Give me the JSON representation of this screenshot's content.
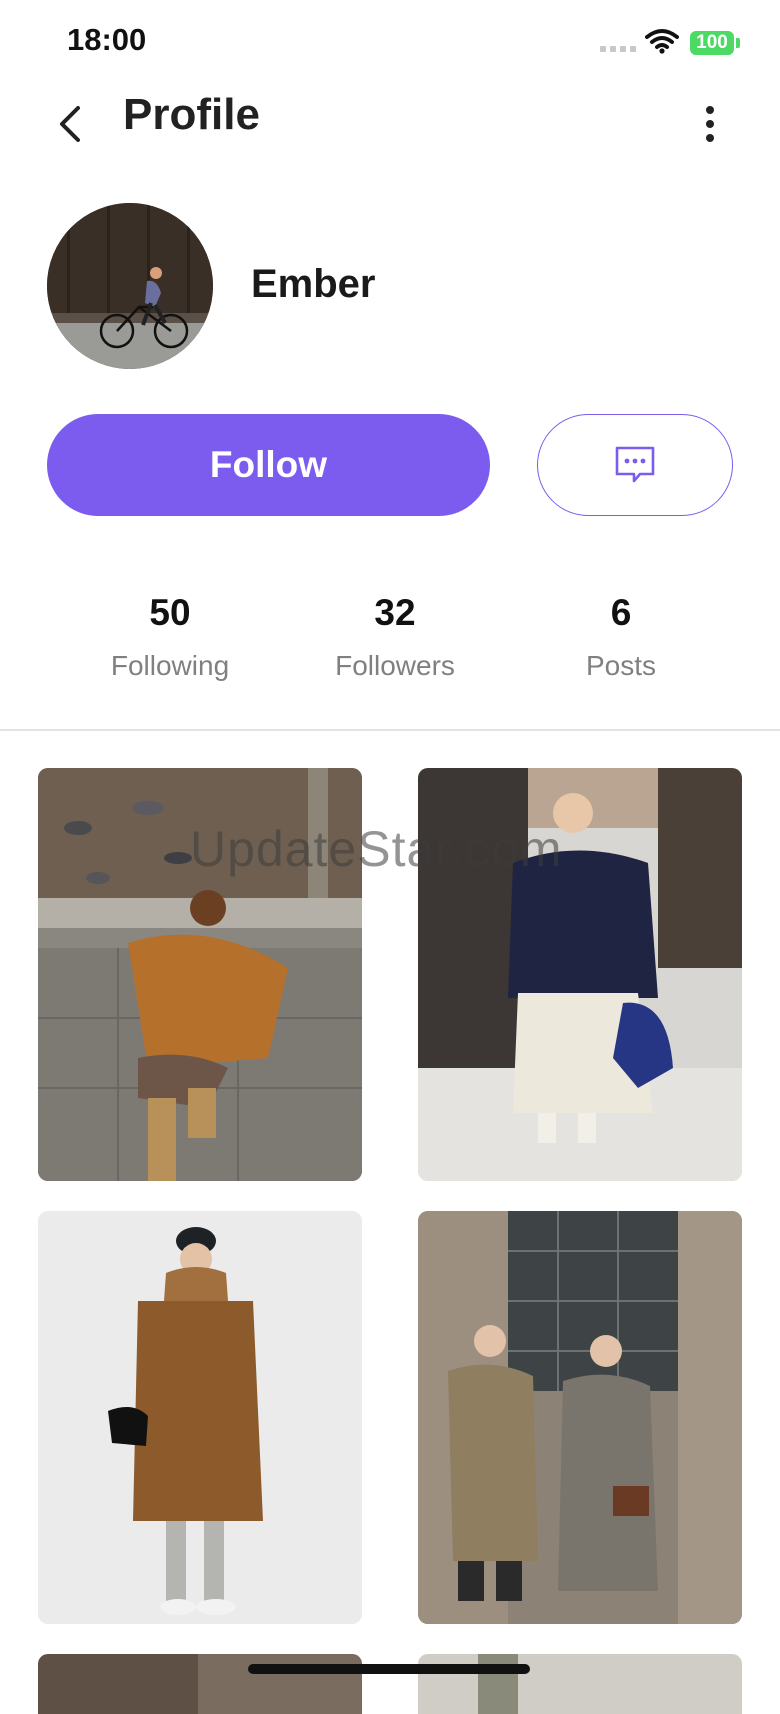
{
  "status_bar": {
    "time": "18:00",
    "battery": "100"
  },
  "nav": {
    "title": "Profile"
  },
  "profile": {
    "name": "Ember"
  },
  "actions": {
    "follow_label": "Follow"
  },
  "stats": [
    {
      "value": "50",
      "label": "Following"
    },
    {
      "value": "32",
      "label": "Followers"
    },
    {
      "value": "6",
      "label": "Posts"
    }
  ],
  "watermark": "UpdateStar.com",
  "icons": {
    "back": "chevron-left-icon",
    "more": "more-vertical-icon",
    "message": "message-dots-icon",
    "wifi": "wifi-icon",
    "signal": "signal-icon",
    "battery": "battery-icon"
  },
  "colors": {
    "accent": "#7b5cef",
    "battery": "#4cd964",
    "stat_label": "#808080"
  }
}
